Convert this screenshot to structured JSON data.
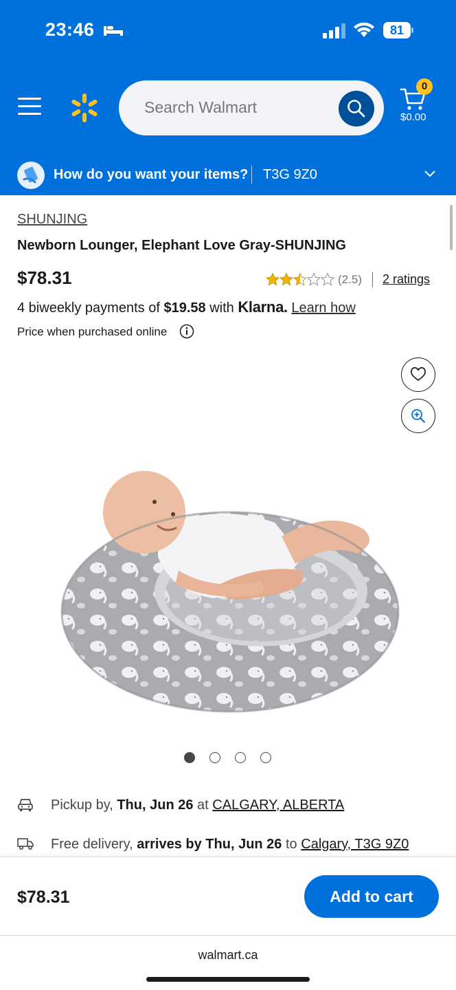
{
  "status_bar": {
    "time": "23:46",
    "battery": "81"
  },
  "header": {
    "search_placeholder": "Search Walmart",
    "cart_count": "0",
    "cart_total": "$0.00",
    "delivery_question": "How do you want your items?",
    "postal_code": "T3G 9Z0",
    "brand_color": "#0071dc",
    "spark_color": "#ffc220"
  },
  "product": {
    "brand": "SHUNJING",
    "title": "Newborn Lounger, Elephant Love Gray-SHUNJING",
    "price": "$78.31",
    "rating_value": 2.5,
    "rating_text": "(2.5)",
    "ratings_link": "2 ratings",
    "klarna_prefix": "4 biweekly payments of",
    "klarna_amount": "$19.58",
    "klarna_with": "with",
    "klarna_brand": "Klarna.",
    "learn_how": "Learn how",
    "price_note": "Price when purchased online",
    "image_count": 4,
    "active_image": 1,
    "image_alt": "Baby lying in gray elephant-print lounger"
  },
  "fulfillment": {
    "pickup_prefix": "Pickup by,",
    "pickup_date": "Thu, Jun 26",
    "pickup_at": "at",
    "pickup_location": "CALGARY, ALBERTA",
    "delivery_prefix": "Free delivery,",
    "delivery_date": "arrives by Thu, Jun 26",
    "delivery_to": "to",
    "delivery_location": "Calgary, T3G 9Z0"
  },
  "sticky": {
    "price": "$78.31",
    "add_to_cart": "Add to cart"
  },
  "browser": {
    "url": "walmart.ca"
  }
}
